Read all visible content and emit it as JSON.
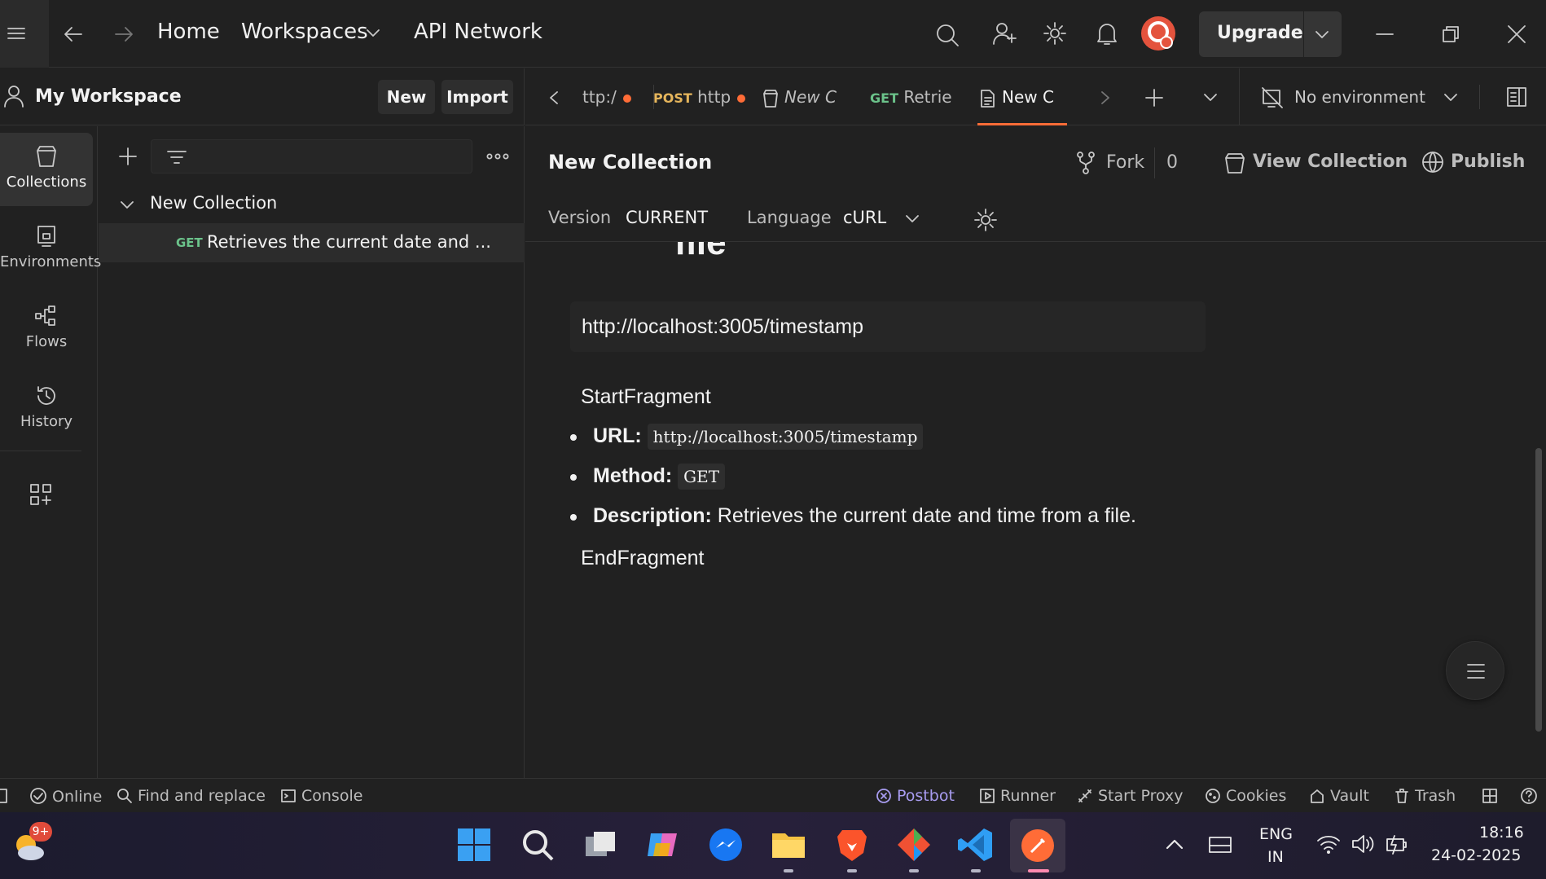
{
  "titlebar": {
    "nav_home": "Home",
    "nav_workspaces": "Workspaces",
    "nav_api_network": "API Network",
    "upgrade_label": "Upgrade"
  },
  "workspace": {
    "name": "My Workspace",
    "new_label": "New",
    "import_label": "Import"
  },
  "tabs": [
    {
      "method": "",
      "label": "ttp:/",
      "unsaved": true
    },
    {
      "method": "POST",
      "label": "http",
      "unsaved": true
    },
    {
      "method": "",
      "label": "New C",
      "italic": true
    },
    {
      "method": "GET",
      "label": "Retrie"
    },
    {
      "method": "",
      "label": "New C",
      "active": true
    }
  ],
  "environment": {
    "label": "No environment"
  },
  "rail": [
    {
      "label": "Collections",
      "active": true
    },
    {
      "label": "Environments"
    },
    {
      "label": "Flows"
    },
    {
      "label": "History"
    }
  ],
  "tree": {
    "collection_name": "New Collection",
    "request_method": "GET",
    "request_label": "Retrieves the current date and ..."
  },
  "main": {
    "title": "New Collection",
    "fork_label": "Fork",
    "fork_count": "0",
    "view_collection": "View Collection",
    "publish": "Publish",
    "version_label": "Version",
    "version_value": "CURRENT",
    "language_label": "Language",
    "language_value": "cURL",
    "heading_fragment": "file",
    "url": "http://localhost:3005/timestamp",
    "start_fragment": "StartFragment",
    "end_fragment": "EndFragment",
    "items": [
      {
        "key": "URL:",
        "code": "http://localhost:3005/timestamp",
        "text": ""
      },
      {
        "key": "Method:",
        "code": "GET",
        "text": ""
      },
      {
        "key": "Description:",
        "code": "",
        "text": " Retrieves the current date and time from a file."
      }
    ]
  },
  "statusbar": {
    "online": "Online",
    "find_replace": "Find and replace",
    "console": "Console",
    "postbot": "Postbot",
    "runner": "Runner",
    "start_proxy": "Start Proxy",
    "cookies": "Cookies",
    "vault": "Vault",
    "trash": "Trash"
  },
  "taskbar": {
    "weather_badge": "9+",
    "lang_top": "ENG",
    "lang_bottom": "IN",
    "time": "18:16",
    "date": "24-02-2025"
  },
  "colors": {
    "accent": "#ff6c37",
    "get": "#6bc28a",
    "post": "#e6b65c"
  }
}
